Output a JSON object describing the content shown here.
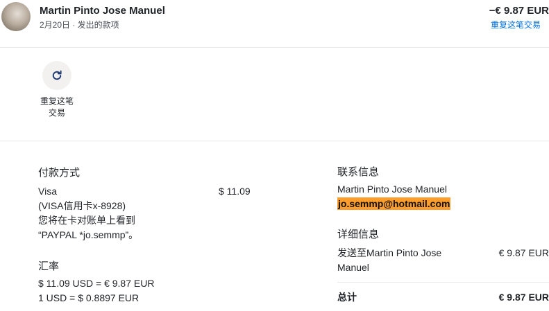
{
  "header": {
    "name": "Martin Pinto Jose Manuel",
    "subtitle": "2月20日 · 发出的款项",
    "amount": "−€ 9.87 EUR",
    "repeat_link": "重复这笔交易"
  },
  "actions": {
    "repeat_line1": "重复这笔",
    "repeat_line2": "交易"
  },
  "payment": {
    "heading": "付款方式",
    "card": "Visa",
    "card_detail": "(VISA信用卡x-8928)",
    "statement_line1": "您将在卡对账单上看到",
    "statement_line2": "“PAYPAL *jo.semmp”。",
    "amount": "$ 11.09"
  },
  "exchange": {
    "heading": "汇率",
    "line1": "$ 11.09 USD = € 9.87 EUR",
    "line2": "1 USD = $ 0.8897 EUR"
  },
  "contact": {
    "heading": "联系信息",
    "name": "Martin Pinto Jose Manuel",
    "email": "jo.semmp@hotmail.com"
  },
  "details": {
    "heading": "详细信息",
    "sent_to_line1": "发送至Martin Pinto Jose",
    "sent_to_line2": "Manuel",
    "sent_amount": "€ 9.87 EUR",
    "total_label": "总计",
    "total_amount": "€ 9.87 EUR"
  },
  "colors": {
    "link": "#0070e0",
    "email_highlight": "#ff9d2c"
  },
  "icons": {
    "avatar": "user-photo",
    "repeat": "refresh-icon"
  }
}
